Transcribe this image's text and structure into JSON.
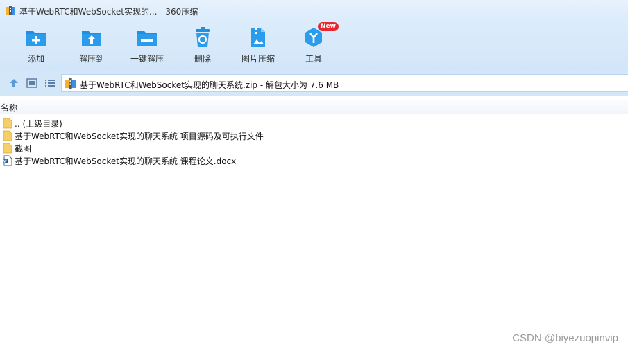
{
  "window": {
    "title": "基于WebRTC和WebSocket实现的... - 360压缩"
  },
  "toolbar": {
    "add_label": "添加",
    "extract_to_label": "解压到",
    "one_click_extract_label": "一键解压",
    "delete_label": "删除",
    "image_compress_label": "图片压缩",
    "tools_label": "工具",
    "tools_badge": "New"
  },
  "address_bar": {
    "path": "基于WebRTC和WebSocket实现的聊天系统.zip - 解包大小为 7.6 MB"
  },
  "file_list": {
    "column_name": "名称",
    "items": [
      {
        "name": ".. (上级目录)",
        "icon": "folder-icon"
      },
      {
        "name": "基于WebRTC和WebSocket实现的聊天系统 项目源码及可执行文件",
        "icon": "folder-icon"
      },
      {
        "name": "截图",
        "icon": "folder-icon"
      },
      {
        "name": "基于WebRTC和WebSocket实现的聊天系统 课程论文.docx",
        "icon": "word-document-icon"
      }
    ]
  },
  "watermark": "CSDN @biyezuopinvip",
  "colors": {
    "accent": "#1f8fe0",
    "toolbar_bg": "#dcecfb",
    "badge": "#e8262e"
  }
}
